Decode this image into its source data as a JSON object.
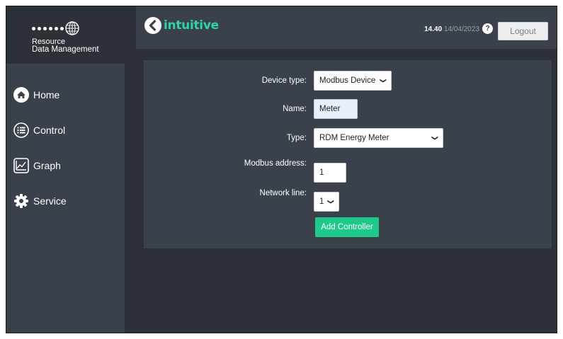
{
  "logo": {
    "line1": "Resource",
    "line2": "Data Management"
  },
  "sidebar": {
    "items": [
      {
        "label": "Home",
        "icon": "home-icon"
      },
      {
        "label": "Control",
        "icon": "list-icon"
      },
      {
        "label": "Graph",
        "icon": "graph-icon"
      },
      {
        "label": "Service",
        "icon": "gear-icon"
      }
    ]
  },
  "header": {
    "brand": "intuitive",
    "time": "14.40",
    "date": "14/04/2023",
    "help_label": "?",
    "logout_label": "Logout"
  },
  "form": {
    "device_type": {
      "label": "Device type:",
      "value": "Modbus Device"
    },
    "name": {
      "label": "Name:",
      "value": "Meter"
    },
    "type": {
      "label": "Type:",
      "value": "RDM Energy Meter"
    },
    "modbus_address": {
      "label": "Modbus address:",
      "value": "1"
    },
    "network_line": {
      "label": "Network line:",
      "value": "1"
    },
    "submit_label": "Add Controller"
  },
  "colors": {
    "accent": "#1ec98a",
    "brand": "#2fd4a0",
    "sidebar_bg": "#3b414a",
    "page_bg": "#2c3138"
  }
}
